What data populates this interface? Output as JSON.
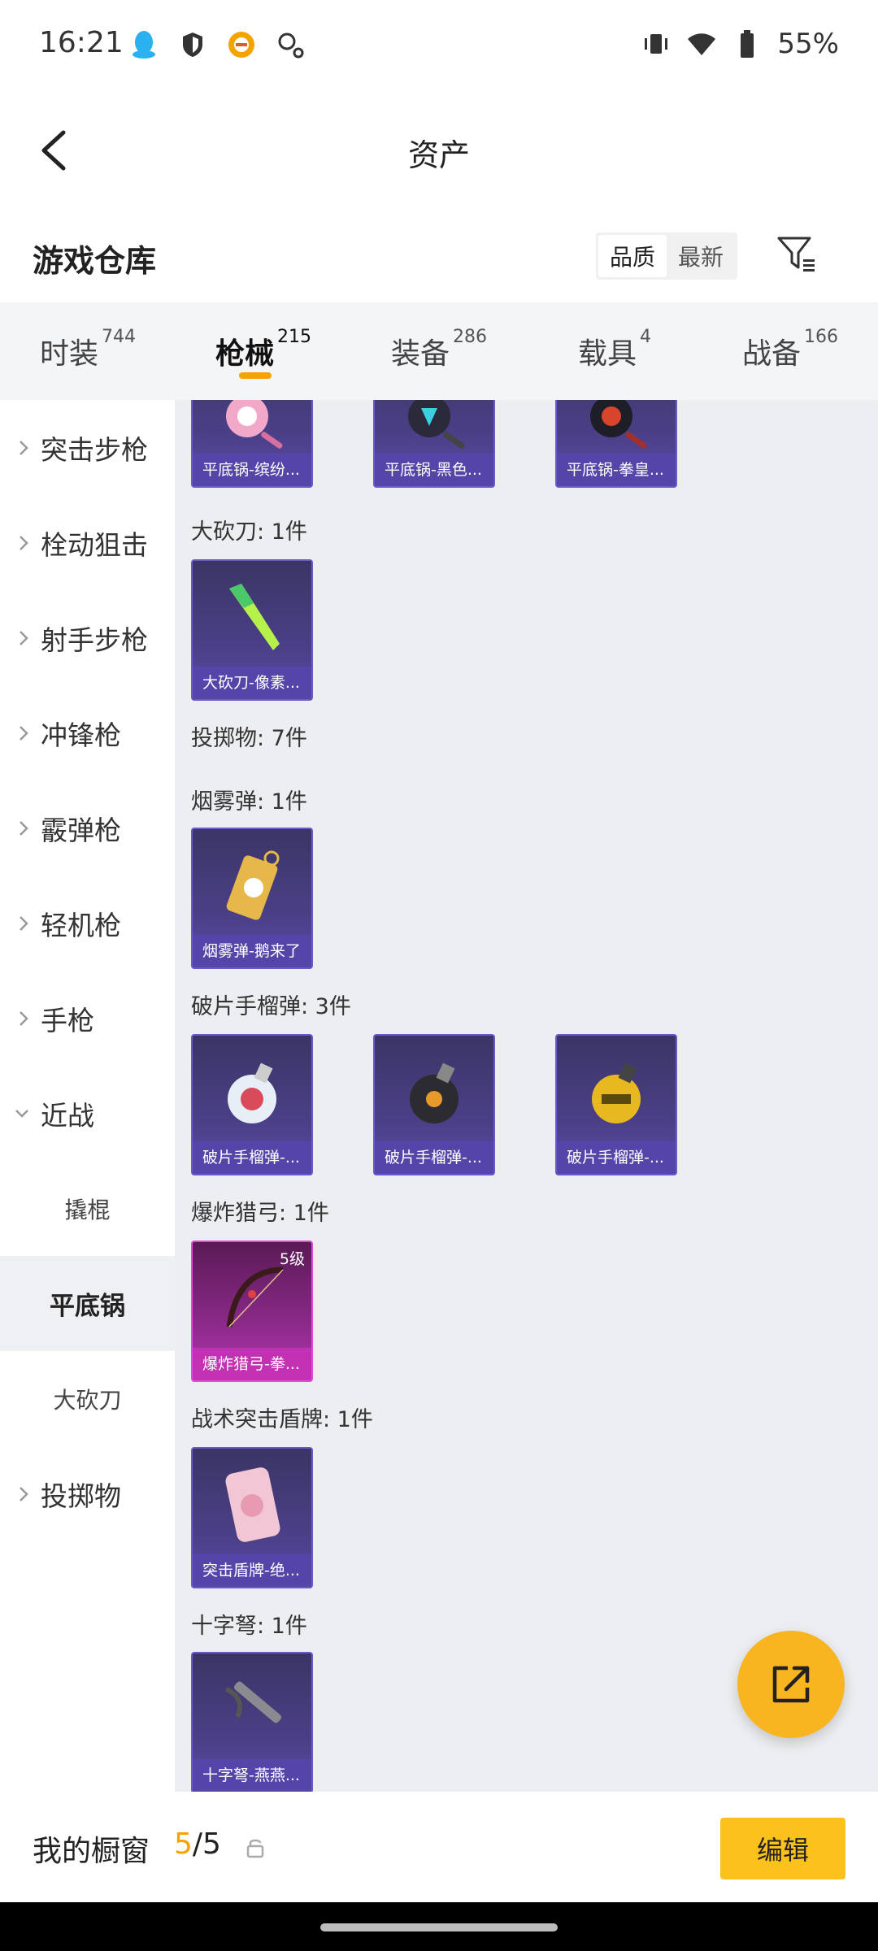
{
  "status_bar": {
    "time": "16:21",
    "battery": "55%",
    "left_icons": [
      "qq-icon",
      "shield-icon",
      "app-notification-icon",
      "search-icon"
    ],
    "right_icons": [
      "vibrate-icon",
      "wifi-icon",
      "battery-icon"
    ]
  },
  "app_bar": {
    "title": "资产",
    "back_icon": "chevron-left-icon"
  },
  "warehouse": {
    "title": "游戏仓库",
    "sort_options": [
      "品质",
      "最新"
    ],
    "sort_selected": "品质",
    "filter_icon": "filter-icon"
  },
  "tabs": [
    {
      "label": "时装",
      "count": "744"
    },
    {
      "label": "枪械",
      "count": "215",
      "active": true
    },
    {
      "label": "装备",
      "count": "286"
    },
    {
      "label": "载具",
      "count": "4"
    },
    {
      "label": "战备",
      "count": "166"
    }
  ],
  "sidebar": {
    "items": [
      {
        "label": "突击步枪"
      },
      {
        "label": "栓动狙击"
      },
      {
        "label": "射手步枪"
      },
      {
        "label": "冲锋枪"
      },
      {
        "label": "霰弹枪"
      },
      {
        "label": "轻机枪"
      },
      {
        "label": "手枪"
      },
      {
        "label": "近战",
        "expanded": true
      },
      {
        "label": "撬棍"
      },
      {
        "label": "平底锅",
        "active": true
      },
      {
        "label": "大砍刀"
      },
      {
        "label": "投掷物"
      }
    ]
  },
  "content": {
    "sections": [
      {
        "label": "",
        "items": [
          "平底锅-缤纷...",
          "平底锅-黑色...",
          "平底锅-拳皇..."
        ]
      },
      {
        "label": "大砍刀: 1件",
        "items": [
          "大砍刀-像素..."
        ]
      },
      {
        "label": "投掷物: 7件",
        "items": []
      },
      {
        "label": "烟雾弹: 1件",
        "items": [
          "烟雾弹-鹅来了"
        ]
      },
      {
        "label": "破片手榴弹: 3件",
        "items": [
          "破片手榴弹-...",
          "破片手榴弹-...",
          "破片手榴弹-..."
        ]
      },
      {
        "label": "爆炸猎弓: 1件",
        "items": [
          "爆炸猎弓-拳..."
        ],
        "level": "5级"
      },
      {
        "label": "战术突击盾牌: 1件",
        "items": [
          "突击盾牌-绝..."
        ]
      },
      {
        "label": "十字弩: 1件",
        "items": [
          "十字弩-燕燕..."
        ]
      }
    ]
  },
  "fab": {
    "icon": "share-out-icon"
  },
  "bottom_bar": {
    "label": "我的橱窗",
    "count_current": "5",
    "count_sep": "/",
    "count_total": "5",
    "edit_label": "编辑"
  },
  "colors": {
    "accent": "#f5a300",
    "card_purple": "#4a3f86",
    "card_pink": "#b536b0",
    "fab": "#f9b51f"
  }
}
